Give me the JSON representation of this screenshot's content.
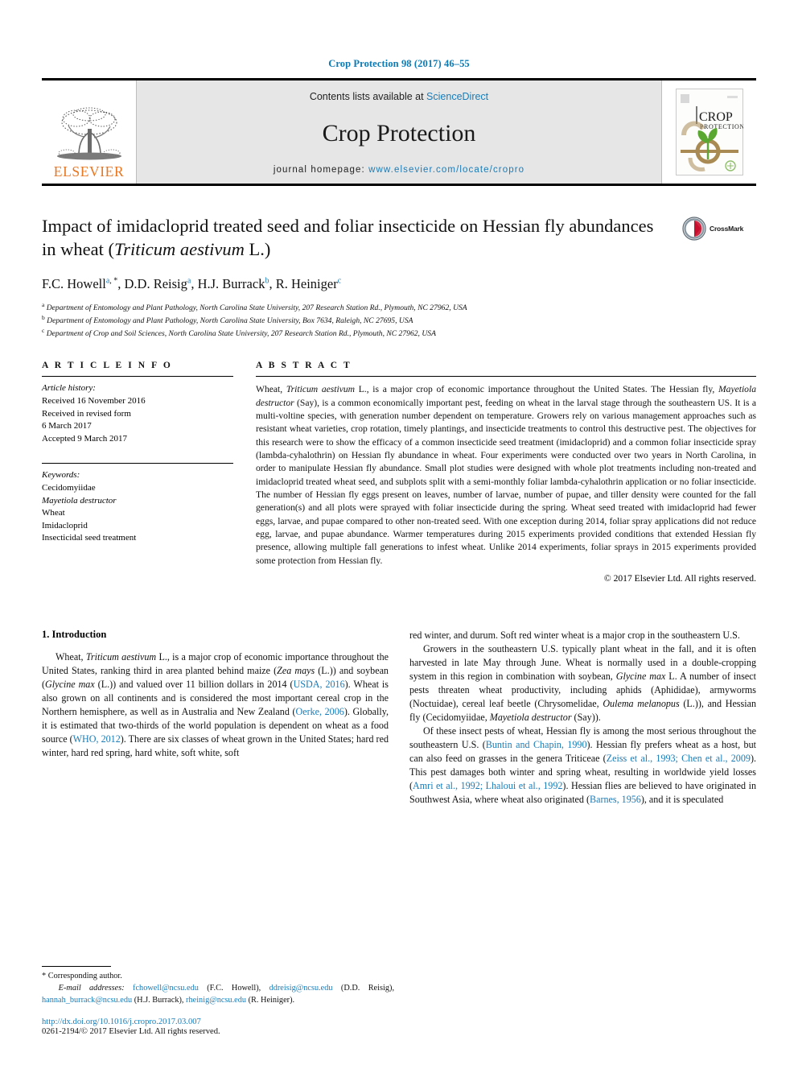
{
  "running_head": "Crop Protection 98 (2017) 46–55",
  "masthead": {
    "contents_prefix": "Contents lists available at ",
    "sciencedirect": "ScienceDirect",
    "journal_name": "Crop Protection",
    "homepage_prefix": "journal homepage: ",
    "homepage_url": "www.elsevier.com/locate/cropro",
    "publisher_wordmark": "ELSEVIER",
    "cover_title_line1": "CROP",
    "cover_title_line2": "PROTECTION"
  },
  "badge": {
    "crossmark_label": "CrossMark"
  },
  "article": {
    "title_part1": "Impact of imidacloprid treated seed and foliar insecticide on Hessian fly abundances in wheat (",
    "title_italic": "Triticum aestivum",
    "title_part2": " L.)",
    "authors": [
      {
        "name": "F.C. Howell",
        "sup": "a",
        "star": true
      },
      {
        "name": "D.D. Reisig",
        "sup": "a",
        "star": false
      },
      {
        "name": "H.J. Burrack",
        "sup": "b",
        "star": false
      },
      {
        "name": "R. Heiniger",
        "sup": "c",
        "star": false
      }
    ],
    "affiliations": [
      {
        "marker": "a",
        "text": "Department of Entomology and Plant Pathology, North Carolina State University, 207 Research Station Rd., Plymouth, NC 27962, USA"
      },
      {
        "marker": "b",
        "text": "Department of Entomology and Plant Pathology, North Carolina State University, Box 7634, Raleigh, NC 27695, USA"
      },
      {
        "marker": "c",
        "text": "Department of Crop and Soil Sciences, North Carolina State University, 207 Research Station Rd., Plymouth, NC 27962, USA"
      }
    ]
  },
  "article_info": {
    "heading": "A R T I C L E  I N F O",
    "history_label": "Article history:",
    "history": [
      "Received 16 November 2016",
      "Received in revised form",
      "6 March 2017",
      "Accepted 9 March 2017"
    ],
    "keywords_label": "Keywords:",
    "keywords": [
      "Cecidomyiidae",
      "Mayetiola destructor",
      "Wheat",
      "Imidacloprid",
      "Insecticidal seed treatment"
    ]
  },
  "abstract": {
    "heading": "A B S T R A C T",
    "p1_a": "Wheat, ",
    "p1_sci1": "Triticum aestivum",
    "p1_b": " L., is a major crop of economic importance throughout the United States. The Hessian fly, ",
    "p1_sci2": "Mayetiola destructor",
    "p1_c": " (Say), is a common economically important pest, feeding on wheat in the larval stage through the southeastern US. It is a multi-voltine species, with generation number dependent on temperature. Growers rely on various management approaches such as resistant wheat varieties, crop rotation, timely plantings, and insecticide treatments to control this destructive pest. The objectives for this research were to show the efficacy of a common insecticide seed treatment (imidacloprid) and a common foliar insecticide spray (lambda-cyhalothrin) on Hessian fly abundance in wheat. Four experiments were conducted over two years in North Carolina, in order to manipulate Hessian fly abundance. Small plot studies were designed with whole plot treatments including non-treated and imidacloprid treated wheat seed, and subplots split with a semi-monthly foliar lambda-cyhalothrin application or no foliar insecticide. The number of Hessian fly eggs present on leaves, number of larvae, number of pupae, and tiller density were counted for the fall generation(s) and all plots were sprayed with foliar insecticide during the spring. Wheat seed treated with imidacloprid had fewer eggs, larvae, and pupae compared to other non-treated seed. With one exception during 2014, foliar spray applications did not reduce egg, larvae, and pupae abundance. Warmer temperatures during 2015 experiments provided conditions that extended Hessian fly presence, allowing multiple fall generations to infest wheat. Unlike 2014 experiments, foliar sprays in 2015 experiments provided some protection from Hessian fly.",
    "copyright": "© 2017 Elsevier Ltd. All rights reserved."
  },
  "introduction": {
    "heading": "1. Introduction",
    "left": {
      "p1_a": "Wheat, ",
      "p1_sci1": "Triticum aestivum",
      "p1_b": " L., is a major crop of economic importance throughout the United States, ranking third in area planted behind maize (",
      "p1_sci2": "Zea mays",
      "p1_c": " (L.)) and soybean (",
      "p1_sci3": "Glycine max",
      "p1_d": " (L.)) and valued over 11 billion dollars in 2014 (",
      "p1_cite1": "USDA, 2016",
      "p1_e": "). Wheat is also grown on all continents and is considered the most important cereal crop in the Northern hemisphere, as well as in Australia and New Zealand (",
      "p1_cite2": "Oerke, 2006",
      "p1_f": "). Globally, it is estimated that two-thirds of the world population is dependent on wheat as a food source (",
      "p1_cite3": "WHO, 2012",
      "p1_g": "). There are six classes of wheat grown in the United States; hard red winter, hard red spring, hard white, soft white, soft"
    },
    "right": {
      "p1": "red winter, and durum. Soft red winter wheat is a major crop in the southeastern U.S.",
      "p2_a": "Growers in the southeastern U.S. typically plant wheat in the fall, and it is often harvested in late May through June. Wheat is normally used in a double-cropping system in this region in combination with soybean, ",
      "p2_sci1": "Glycine max",
      "p2_b": " L. A number of insect pests threaten wheat productivity, including aphids (Aphididae), armyworms (Noctuidae), cereal leaf beetle (Chrysomelidae, ",
      "p2_sci2": "Oulema melanopus",
      "p2_c": " (L.)), and Hessian fly (Cecidomyiidae, ",
      "p2_sci3": "Mayetiola destructor",
      "p2_d": " (Say)).",
      "p3_a": "Of these insect pests of wheat, Hessian fly is among the most serious throughout the southeastern U.S. (",
      "p3_cite1": "Buntin and Chapin, 1990",
      "p3_b": "). Hessian fly prefers wheat as a host, but can also feed on grasses in the genera Triticeae (",
      "p3_cite2": "Zeiss et al., 1993; Chen et al., 2009",
      "p3_c": "). This pest damages both winter and spring wheat, resulting in worldwide yield losses (",
      "p3_cite3": "Amri et al., 1992; Lhaloui et al., 1992",
      "p3_d": "). Hessian flies are believed to have originated in Southwest Asia, where wheat also originated (",
      "p3_cite4": "Barnes, 1956",
      "p3_e": "), and it is speculated"
    }
  },
  "footnote": {
    "corresponding": "* Corresponding author.",
    "email_label": "E-mail addresses:",
    "emails": [
      {
        "address": "fchowell@ncsu.edu",
        "owner": "(F.C. Howell)"
      },
      {
        "address": "ddreisig@ncsu.edu",
        "owner": "(D.D. Reisig)"
      },
      {
        "address": "hannah_burrack@ncsu.edu",
        "owner": "(H.J. Burrack)"
      },
      {
        "address": "rheinig@ncsu.edu",
        "owner": "(R. Heiniger)"
      }
    ],
    "doi": "http://dx.doi.org/10.1016/j.cropro.2017.03.007",
    "issn_copyright": "0261-2194/© 2017 Elsevier Ltd. All rights reserved."
  },
  "colors": {
    "link_blue": "#1a7cb8",
    "elsevier_orange": "#e87722",
    "cover_green": "#5aa832",
    "cover_tan": "#a98a53"
  }
}
